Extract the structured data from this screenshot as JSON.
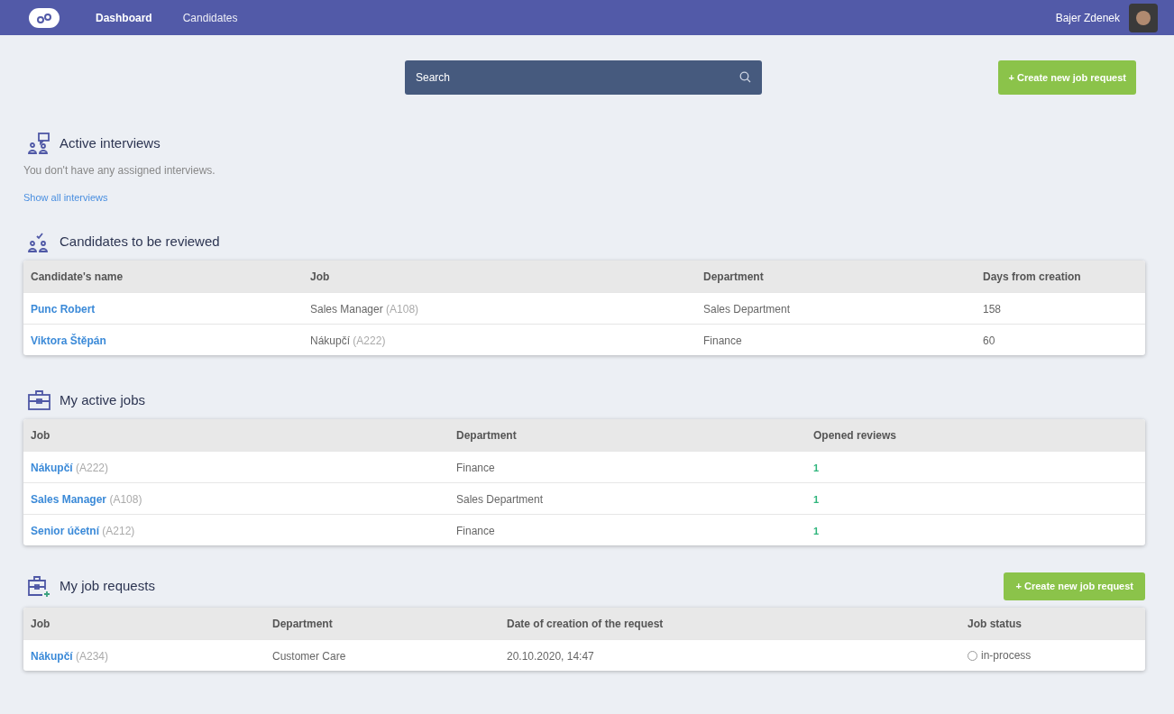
{
  "nav": {
    "items": [
      {
        "label": "Dashboard",
        "selected": true
      },
      {
        "label": "Candidates",
        "selected": false
      }
    ],
    "user": "Bajer Zdenek"
  },
  "search": {
    "placeholder": "Search"
  },
  "create_button": "+ Create new job request",
  "active_interviews": {
    "title": "Active interviews",
    "message": "You don't have any assigned interviews.",
    "link": "Show all interviews"
  },
  "candidates_to_review": {
    "title": "Candidates to be reviewed",
    "columns": [
      "Candidate's name",
      "Job",
      "Department",
      "Days from creation"
    ],
    "rows": [
      [
        {
          "kind": "link",
          "text": "Punc Robert"
        },
        {
          "kind": "text",
          "text": "Sales Manager",
          "code": "(A108)"
        },
        {
          "kind": "text",
          "text": "Sales Department"
        },
        {
          "kind": "text",
          "text": "158"
        }
      ],
      [
        {
          "kind": "link",
          "text": "Viktora Štěpán"
        },
        {
          "kind": "text",
          "text": "Nákupčí",
          "code": "(A222)"
        },
        {
          "kind": "text",
          "text": "Finance"
        },
        {
          "kind": "text",
          "text": "60"
        }
      ]
    ]
  },
  "my_active_jobs": {
    "title": "My active jobs",
    "columns": [
      "Job",
      "Department",
      "Opened reviews"
    ],
    "rows": [
      [
        {
          "kind": "link",
          "text": "Nákupčí",
          "code": "(A222)"
        },
        {
          "kind": "text",
          "text": "Finance"
        },
        {
          "kind": "count",
          "text": "1"
        }
      ],
      [
        {
          "kind": "link",
          "text": "Sales Manager",
          "code": "(A108)"
        },
        {
          "kind": "text",
          "text": "Sales Department"
        },
        {
          "kind": "count",
          "text": "1"
        }
      ],
      [
        {
          "kind": "link",
          "text": "Senior účetní",
          "code": "(A212)"
        },
        {
          "kind": "text",
          "text": "Finance"
        },
        {
          "kind": "count",
          "text": "1"
        }
      ]
    ]
  },
  "my_job_requests": {
    "title": "My job requests",
    "button": "+ Create new job request",
    "columns": [
      "Job",
      "Department",
      "Date of creation of the request",
      "Job status"
    ],
    "rows": [
      [
        {
          "kind": "link",
          "text": "Nákupčí",
          "code": "(A234)"
        },
        {
          "kind": "text",
          "text": "Customer Care"
        },
        {
          "kind": "text",
          "text": "20.10.2020, 14:47"
        },
        {
          "kind": "status",
          "text": "in-process"
        }
      ]
    ]
  }
}
